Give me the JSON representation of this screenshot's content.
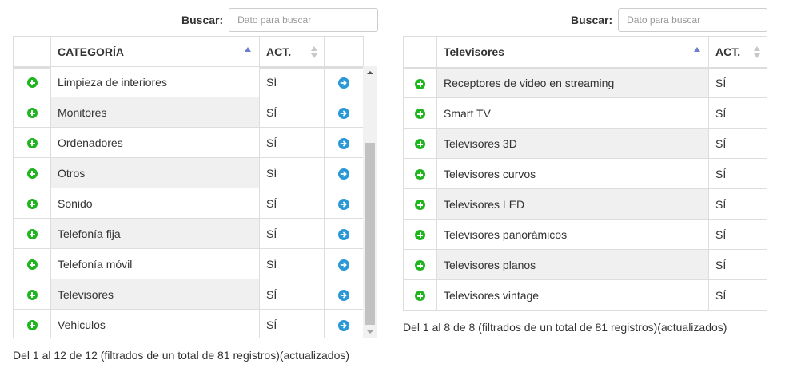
{
  "left": {
    "search_label": "Buscar:",
    "search_placeholder": "Dato para buscar",
    "headers": [
      "",
      "CATEGORÍA",
      "ACT.",
      ""
    ],
    "rows": [
      {
        "name": "Limpieza de interiores",
        "act": "SÍ"
      },
      {
        "name": "Monitores",
        "act": "SÍ"
      },
      {
        "name": "Ordenadores",
        "act": "SÍ"
      },
      {
        "name": "Otros",
        "act": "SÍ"
      },
      {
        "name": "Sonido",
        "act": "SÍ"
      },
      {
        "name": "Telefonía fija",
        "act": "SÍ"
      },
      {
        "name": "Telefonía móvil",
        "act": "SÍ"
      },
      {
        "name": "Televisores",
        "act": "SÍ"
      },
      {
        "name": "Vehiculos",
        "act": "SÍ"
      }
    ],
    "info": "Del 1 al 12 de 12 (filtrados de un total de 81 registros)(actualizados)"
  },
  "right": {
    "search_label": "Buscar:",
    "search_placeholder": "Dato para buscar",
    "headers": [
      "",
      "Televisores",
      "ACT."
    ],
    "rows": [
      {
        "name": "Receptores de video en streaming",
        "act": "SÍ"
      },
      {
        "name": "Smart TV",
        "act": "SÍ"
      },
      {
        "name": "Televisores 3D",
        "act": "SÍ"
      },
      {
        "name": "Televisores curvos",
        "act": "SÍ"
      },
      {
        "name": "Televisores LED",
        "act": "SÍ"
      },
      {
        "name": "Televisores panorámicos",
        "act": "SÍ"
      },
      {
        "name": "Televisores planos",
        "act": "SÍ"
      },
      {
        "name": "Televisores vintage",
        "act": "SÍ"
      }
    ],
    "info": "Del 1 al 8 de 8 (filtrados de un total de 81 registros)(actualizados)"
  },
  "colors": {
    "add_icon": "#1fb51f",
    "go_icon": "#2a98d6",
    "sort_active": "#6d7fcc",
    "row_shade": "#f0f0f0"
  },
  "icons": {
    "add": "plus-circle-icon",
    "go": "arrow-right-circle-icon"
  }
}
